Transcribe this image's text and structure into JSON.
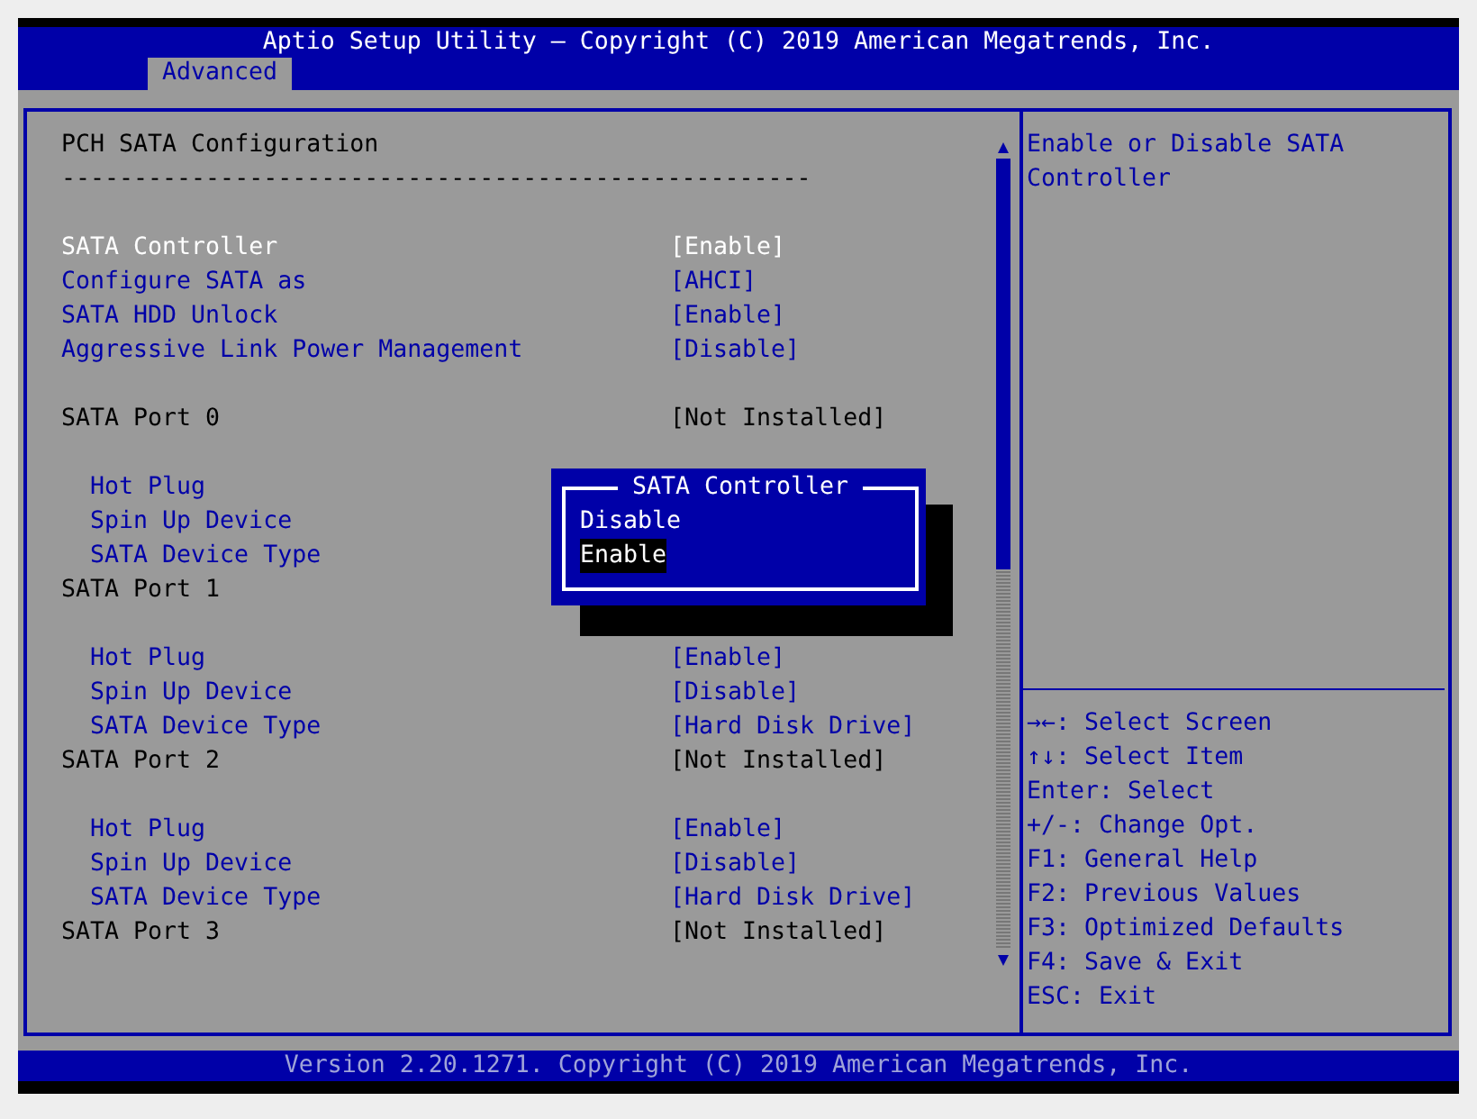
{
  "header": {
    "title": "Aptio Setup Utility – Copyright (C) 2019 American Megatrends, Inc.",
    "tabs": [
      {
        "label": "Advanced",
        "selected": true
      }
    ]
  },
  "settings": {
    "title": "PCH SATA Configuration",
    "separator": "----------------------------------------------------",
    "options": [
      {
        "kind": "option",
        "label": "SATA Controller",
        "value": "[Enable]",
        "selected": true
      },
      {
        "kind": "option",
        "label": "Configure SATA as",
        "value": "[AHCI]",
        "selected": false
      },
      {
        "kind": "option",
        "label": "SATA HDD Unlock",
        "value": "[Enable]",
        "selected": false
      },
      {
        "kind": "option",
        "label": "Aggressive Link Power Management",
        "value": "[Disable]",
        "selected": false
      }
    ],
    "ports": [
      {
        "kind": "info",
        "label": "SATA Port 0",
        "value": "[Not Installed]",
        "children": [
          {
            "kind": "option",
            "label": "Hot Plug",
            "selected": false
          },
          {
            "kind": "option",
            "label": "Spin Up Device",
            "selected": false
          },
          {
            "kind": "option",
            "label": "SATA Device Type",
            "selected": false
          }
        ]
      },
      {
        "kind": "info",
        "label": "SATA Port 1",
        "children": [
          {
            "kind": "option",
            "label": "Hot Plug",
            "value": "[Enable]",
            "selected": false
          },
          {
            "kind": "option",
            "label": "Spin Up Device",
            "value": "[Disable]",
            "selected": false
          },
          {
            "kind": "option",
            "label": "SATA Device Type",
            "value": "[Hard Disk Drive]",
            "selected": false
          }
        ]
      },
      {
        "kind": "info",
        "label": "SATA Port 2",
        "value": "[Not Installed]",
        "children": [
          {
            "kind": "option",
            "label": "Hot Plug",
            "value": "[Enable]",
            "selected": false
          },
          {
            "kind": "option",
            "label": "Spin Up Device",
            "value": "[Disable]",
            "selected": false
          },
          {
            "kind": "option",
            "label": "SATA Device Type",
            "value": "[Hard Disk Drive]",
            "selected": false
          }
        ]
      },
      {
        "kind": "info",
        "label": "SATA Port 3",
        "value": "[Not Installed]"
      }
    ]
  },
  "popup": {
    "title": "SATA Controller",
    "options": [
      {
        "label": "Disable",
        "selected": false
      },
      {
        "label": "Enable",
        "selected": true
      }
    ]
  },
  "help": {
    "text": "Enable or Disable SATA Controller",
    "keys": [
      "→←: Select Screen",
      "↑↓: Select Item",
      "Enter: Select",
      "+/-: Change Opt.",
      "F1: General Help",
      "F2: Previous Values",
      "F3: Optimized Defaults",
      "F4: Save & Exit",
      "ESC: Exit"
    ]
  },
  "status_bar": "Version 2.20.1271. Copyright (C) 2019 American Megatrends, Inc."
}
